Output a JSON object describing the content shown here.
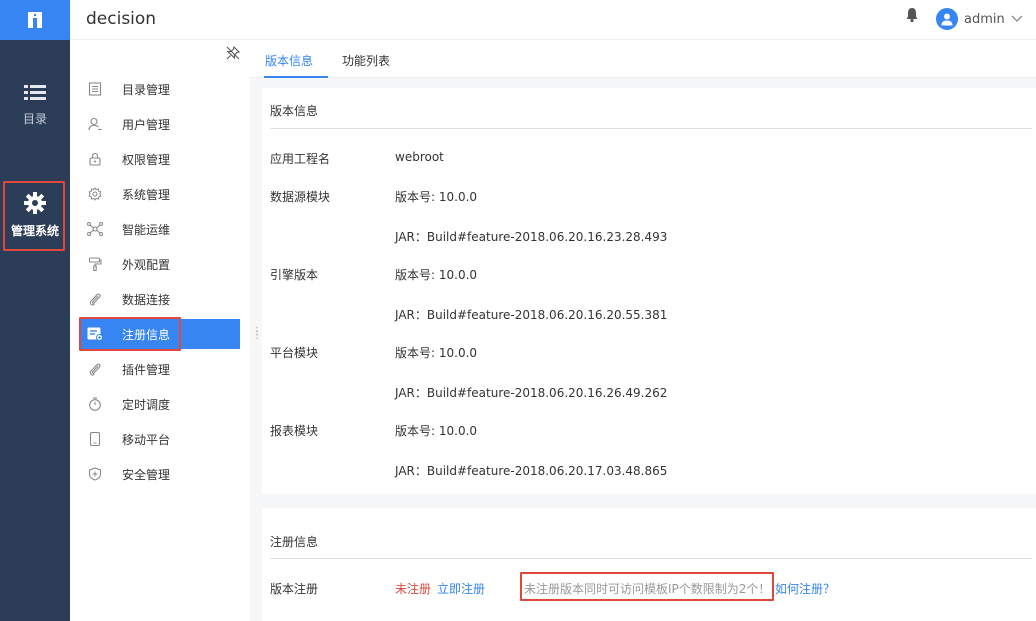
{
  "app": {
    "title": "decision"
  },
  "header": {
    "username": "admin"
  },
  "rail": {
    "items": [
      {
        "label": "目录",
        "icon": "list-icon"
      },
      {
        "label": "管理系统",
        "icon": "gear-icon"
      }
    ]
  },
  "menu": {
    "items": [
      {
        "label": "目录管理",
        "icon": "catalog-icon"
      },
      {
        "label": "用户管理",
        "icon": "user-icon"
      },
      {
        "label": "权限管理",
        "icon": "lock-icon"
      },
      {
        "label": "系统管理",
        "icon": "gear-icon"
      },
      {
        "label": "智能运维",
        "icon": "network-icon"
      },
      {
        "label": "外观配置",
        "icon": "paint-roller-icon"
      },
      {
        "label": "数据连接",
        "icon": "paperclip-icon"
      },
      {
        "label": "注册信息",
        "icon": "register-icon"
      },
      {
        "label": "插件管理",
        "icon": "plugin-icon"
      },
      {
        "label": "定时调度",
        "icon": "timer-icon"
      },
      {
        "label": "移动平台",
        "icon": "mobile-icon"
      },
      {
        "label": "安全管理",
        "icon": "shield-icon"
      }
    ]
  },
  "tabs": [
    {
      "label": "版本信息"
    },
    {
      "label": "功能列表"
    }
  ],
  "version_panel": {
    "title": "版本信息",
    "project_label": "应用工程名",
    "project_value": "webroot",
    "modules": [
      {
        "name": "数据源模块",
        "version": "版本号: 10.0.0",
        "jar": "JAR：Build#feature-2018.06.20.16.23.28.493"
      },
      {
        "name": "引擎版本",
        "version": "版本号: 10.0.0",
        "jar": "JAR：Build#feature-2018.06.20.16.20.55.381"
      },
      {
        "name": "平台模块",
        "version": "版本号: 10.0.0",
        "jar": "JAR：Build#feature-2018.06.20.16.26.49.262"
      },
      {
        "name": "报表模块",
        "version": "版本号: 10.0.0",
        "jar": "JAR：Build#feature-2018.06.20.17.03.48.865"
      }
    ]
  },
  "register_panel": {
    "title": "注册信息",
    "label": "版本注册",
    "status": "未注册",
    "register_now": "立即注册",
    "notice": "未注册版本同时可访问模板IP个数限制为2个！",
    "how_to": "如何注册？"
  }
}
